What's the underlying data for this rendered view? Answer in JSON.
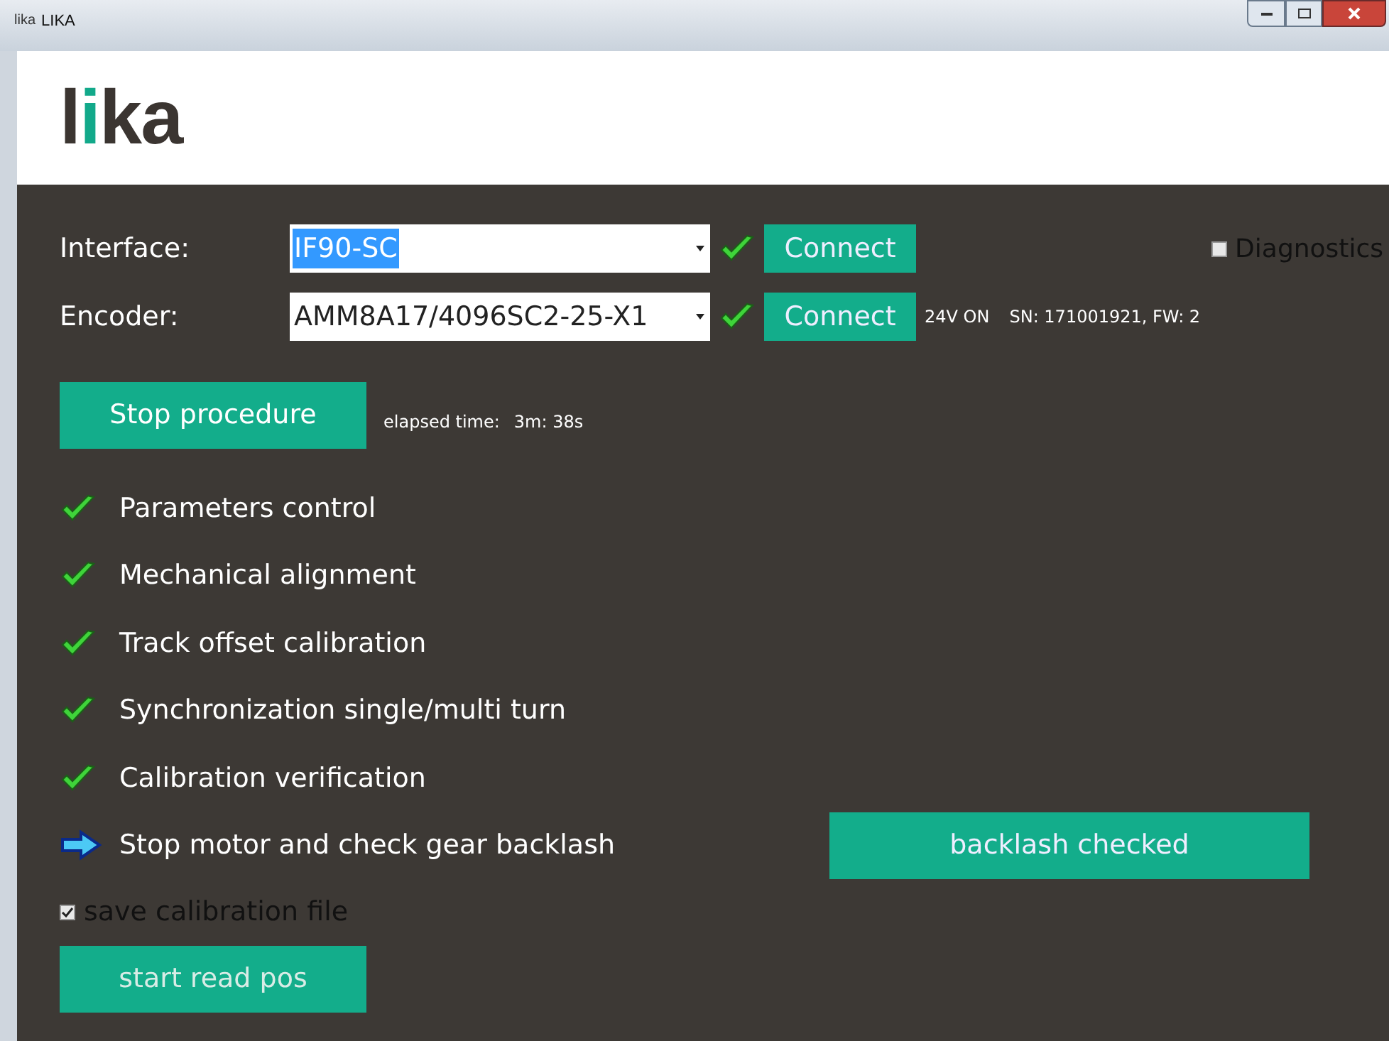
{
  "window": {
    "icon_text": "lika",
    "title": "LIKA"
  },
  "logo": "lika",
  "connections": [
    {
      "label": "Interface:",
      "value": "IF90-SC",
      "text_selected": true,
      "ok": true,
      "button": "Connect"
    },
    {
      "label": "Encoder:",
      "value": "AMM8A17/4096SC2-25-X1",
      "text_selected": false,
      "ok": true,
      "button": "Connect",
      "power": "24V ON",
      "info": "SN: 171001921, FW: 2"
    }
  ],
  "diagnostics": {
    "label": "Diagnostics",
    "checked": false
  },
  "procedure": {
    "button": "Stop procedure",
    "elapsed_label": "elapsed time:",
    "elapsed": "3m: 38s"
  },
  "steps": [
    {
      "label": "Parameters control",
      "kind": "done"
    },
    {
      "label": "Mechanical alignment",
      "kind": "done"
    },
    {
      "label": "Track offset calibration",
      "kind": "done"
    },
    {
      "label": "Synchronization single/multi turn",
      "kind": "done"
    },
    {
      "label": "Calibration verification",
      "kind": "done"
    },
    {
      "label": "Stop motor and check gear backlash",
      "kind": "current",
      "action": "backlash checked"
    }
  ],
  "save_file": {
    "label": "save calibration file",
    "checked": true
  },
  "read_button": "start read pos"
}
